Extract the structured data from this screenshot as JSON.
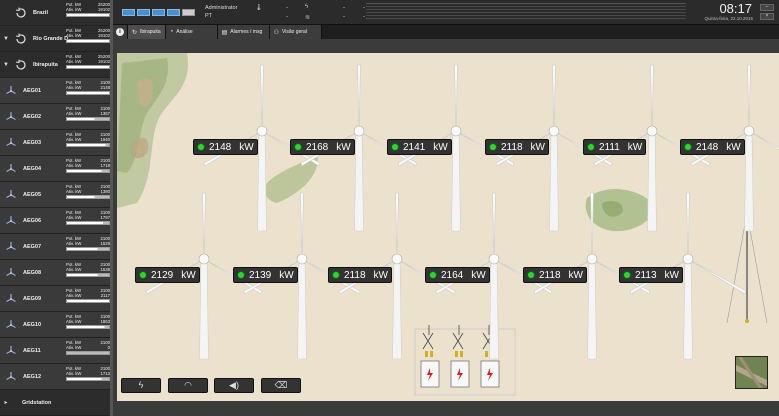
{
  "sidebar": {
    "regions": [
      {
        "name": "Brazil",
        "pot_label": "Pot. kW",
        "pot_value": "25200",
        "ativ_label": "Ativ. kW",
        "ativ_value": "19102"
      },
      {
        "name": "Rio Grande D",
        "pot_label": "Pot. kW",
        "pot_value": "25200",
        "ativ_label": "Ativ. kW",
        "ativ_value": "19102"
      },
      {
        "name": "Ibirapuita",
        "pot_label": "Pot. kW",
        "pot_value": "25200",
        "ativ_label": "Ativ. kW",
        "ativ_value": "19102"
      }
    ],
    "turbines": [
      {
        "name": "AEG01",
        "pot_label": "Pot. kW",
        "pot_value": "2100",
        "ativ_label": "Ativ. kW",
        "ativ_value": "2148",
        "level": 1.0
      },
      {
        "name": "AEG02",
        "pot_label": "Pot. kW",
        "pot_value": "2100",
        "ativ_label": "Ativ. kW",
        "ativ_value": "1367",
        "level": 0.65
      },
      {
        "name": "AEG03",
        "pot_label": "Pot. kW",
        "pot_value": "2100",
        "ativ_label": "Ativ. kW",
        "ativ_value": "1940",
        "level": 0.92
      },
      {
        "name": "AEG04",
        "pot_label": "Pot. kW",
        "pot_value": "2100",
        "ativ_label": "Ativ. kW",
        "ativ_value": "1718",
        "level": 0.82
      },
      {
        "name": "AEG05",
        "pot_label": "Pot. kW",
        "pot_value": "2100",
        "ativ_label": "Ativ. kW",
        "ativ_value": "1380",
        "level": 0.66
      },
      {
        "name": "AEG06",
        "pot_label": "Pot. kW",
        "pot_value": "2100",
        "ativ_label": "Ativ. kW",
        "ativ_value": "1797",
        "level": 0.86
      },
      {
        "name": "AEG07",
        "pot_label": "Pot. kW",
        "pot_value": "2100",
        "ativ_label": "Ativ. kW",
        "ativ_value": "1528",
        "level": 0.73
      },
      {
        "name": "AEG08",
        "pot_label": "Pot. kW",
        "pot_value": "2100",
        "ativ_label": "Ativ. kW",
        "ativ_value": "1538",
        "level": 0.73
      },
      {
        "name": "AEG09",
        "pot_label": "Pot. kW",
        "pot_value": "2100",
        "ativ_label": "Ativ. kW",
        "ativ_value": "2117",
        "level": 1.0
      },
      {
        "name": "AEG10",
        "pot_label": "Pot. kW",
        "pot_value": "2100",
        "ativ_label": "Ativ. kW",
        "ativ_value": "1863",
        "level": 0.89
      },
      {
        "name": "AEG11",
        "pot_label": "Pot. kW",
        "pot_value": "2100",
        "ativ_label": "Ativ. kW",
        "ativ_value": "0",
        "level": 0.0
      },
      {
        "name": "AEG12",
        "pot_label": "Pot. kW",
        "pot_value": "2100",
        "ativ_label": "Ativ. kW",
        "ativ_value": "1713",
        "level": 0.82
      }
    ],
    "gridstation_label": "Gridstation"
  },
  "header": {
    "user": "Administrator",
    "lang": "PT",
    "temp_value": "-",
    "temp_value2": "-",
    "power_value": "-",
    "power_value2": "-",
    "extra_value": "-",
    "extra_value2": "-",
    "time": "08:17",
    "date": "Quinta-feira, 22.10.2015"
  },
  "tabs": [
    {
      "label": "Ibirapuita",
      "icon": "refresh-icon"
    },
    {
      "label": "Análise",
      "icon": "pie-chart-icon"
    },
    {
      "label": "Alarmes / msg",
      "icon": "alarm-list-icon"
    },
    {
      "label": "Visão geral",
      "icon": "network-icon"
    }
  ],
  "turbines_map": [
    {
      "value": "2148",
      "unit": "kW"
    },
    {
      "value": "2168",
      "unit": "kW"
    },
    {
      "value": "2141",
      "unit": "kW"
    },
    {
      "value": "2118",
      "unit": "kW"
    },
    {
      "value": "2111",
      "unit": "kW"
    },
    {
      "value": "2148",
      "unit": "kW"
    },
    {
      "value": "2129",
      "unit": "kW"
    },
    {
      "value": "2139",
      "unit": "kW"
    },
    {
      "value": "2118",
      "unit": "kW"
    },
    {
      "value": "2164",
      "unit": "kW"
    },
    {
      "value": "2118",
      "unit": "kW"
    },
    {
      "value": "2113",
      "unit": "kW"
    }
  ],
  "toolbar": [
    "lightning-icon",
    "gauge-icon",
    "sound-icon",
    "eraser-icon"
  ],
  "colors": {
    "status_ok": "#33d133",
    "canvas_bg": "#ece1cc",
    "accent_blue": "#4a90d0"
  }
}
